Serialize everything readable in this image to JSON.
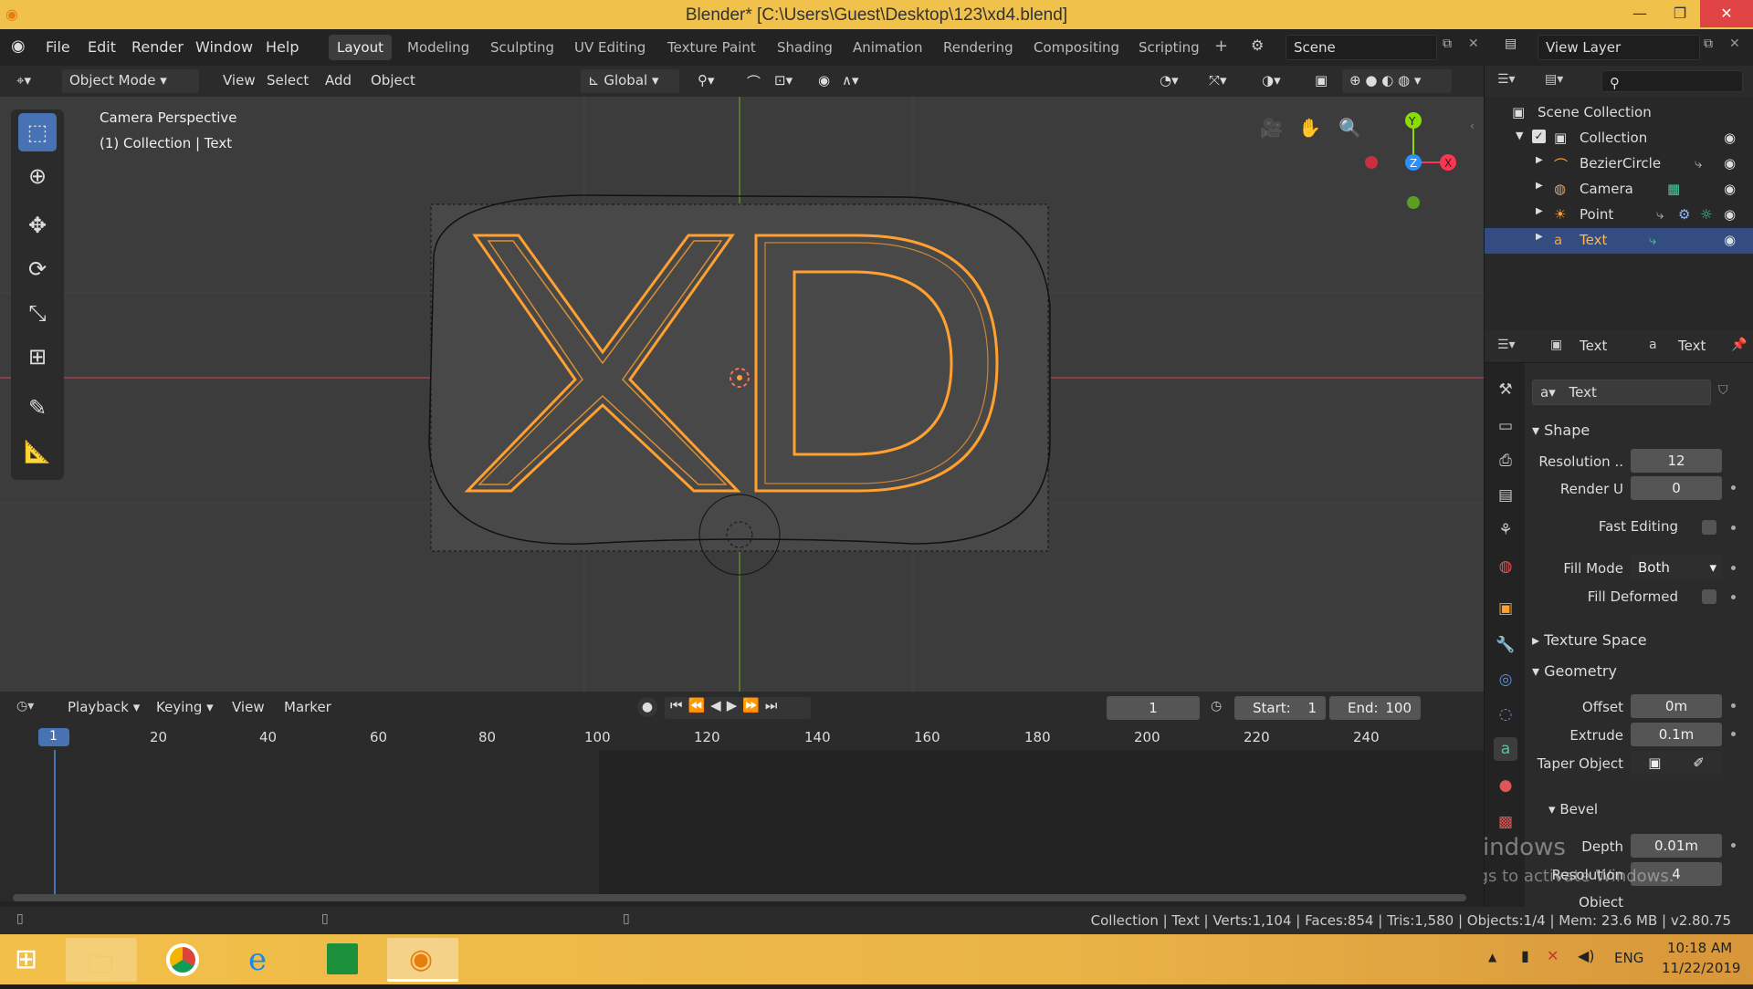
{
  "window": {
    "title": "Blender* [C:\\Users\\Guest\\Desktop\\123\\xd4.blend]"
  },
  "menu": [
    "File",
    "Edit",
    "Render",
    "Window",
    "Help"
  ],
  "workspaces": [
    "Layout",
    "Modeling",
    "Sculpting",
    "UV Editing",
    "Texture Paint",
    "Shading",
    "Animation",
    "Rendering",
    "Compositing",
    "Scripting"
  ],
  "scene": "Scene",
  "view_layer": "View Layer",
  "viewport_header": {
    "mode": "Object Mode",
    "view": "View",
    "select": "Select",
    "add": "Add",
    "object": "Object",
    "orientation": "Global"
  },
  "viewport": {
    "camera_label": "Camera Perspective",
    "collection_label": "(1) Collection | Text",
    "text": "XD",
    "colors": {
      "accent": "#4772b3",
      "selected": "#ffa030",
      "xaxis": "#ff3352",
      "yaxis": "#8bdc00",
      "zaxis": "#2890ff"
    }
  },
  "gizmo": {
    "x": "X",
    "y": "Y",
    "z": "Z"
  },
  "outliner": {
    "root": "Scene Collection",
    "collection": "Collection",
    "items": [
      "BezierCircle",
      "Camera",
      "Point",
      "Text"
    ]
  },
  "props": {
    "header_obj": "Text",
    "header_data": "Text",
    "datablock": "Text",
    "shape": "Shape",
    "res_label": "Resolution ..",
    "res_val": "12",
    "renderu_label": "Render U",
    "renderu_val": "0",
    "fastedit": "Fast Editing",
    "fillmode": "Fill Mode",
    "fillmode_val": "Both",
    "filldeformed": "Fill Deformed",
    "texspace": "Texture Space",
    "geometry": "Geometry",
    "offset_label": "Offset",
    "offset_val": "0m",
    "extrude_label": "Extrude",
    "extrude_val": "0.1m",
    "taper": "Taper Object",
    "bevel": "Bevel",
    "depth_label": "Depth",
    "depth_val": "0.01m",
    "bres_label": "Resolution",
    "bres_val": "4",
    "bobj_label": "Object"
  },
  "activate": {
    "line1": "Activate Windows",
    "line2": "Go to PC settings to activate Windows."
  },
  "timeline": {
    "playback": "Playback",
    "keying": "Keying",
    "view": "View",
    "marker": "Marker",
    "frame": "1",
    "start_label": "Start:",
    "start": "1",
    "end_label": "End:",
    "end": "100",
    "ticks": [
      "1",
      "20",
      "40",
      "60",
      "80",
      "100",
      "120",
      "140",
      "160",
      "180",
      "200",
      "220",
      "240"
    ]
  },
  "status": "Collection | Text | Verts:1,104 | Faces:854 | Tris:1,580 | Objects:1/4 | Mem: 23.6 MB | v2.80.75",
  "taskbar": {
    "lang": "ENG",
    "time": "10:18 AM",
    "date": "11/22/2019"
  }
}
